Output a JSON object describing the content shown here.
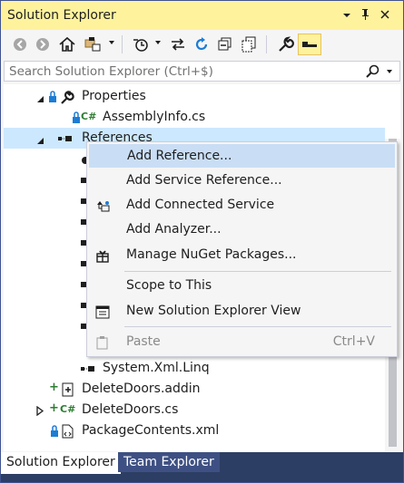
{
  "window": {
    "title": "Solution Explorer"
  },
  "search": {
    "placeholder": "Search Solution Explorer (Ctrl+$)"
  },
  "tree": {
    "properties": "Properties",
    "assembly_info": "AssemblyInfo.cs",
    "references": "References",
    "system_xml_linq": "System.Xml.Linq",
    "addin": "DeleteDoors.addin",
    "cs_file": "DeleteDoors.cs",
    "package_contents": "PackageContents.xml",
    "cs_badge": "C#"
  },
  "context_menu": {
    "items": [
      {
        "label": "Add Reference..."
      },
      {
        "label": "Add Service Reference..."
      },
      {
        "label": "Add Connected Service"
      },
      {
        "label": "Add Analyzer..."
      },
      {
        "label": "Manage NuGet Packages..."
      },
      {
        "label": "Scope to This"
      },
      {
        "label": "New Solution Explorer View"
      },
      {
        "label": "Paste",
        "shortcut": "Ctrl+V",
        "disabled": true
      }
    ]
  },
  "tabs": [
    {
      "label": "Solution Explorer"
    },
    {
      "label": "Team Explorer"
    }
  ],
  "colors": {
    "title_bar": "#fff29d",
    "selection": "#cce8ff",
    "menu_hover": "#c9def5",
    "tab_strip": "#2d3e64",
    "csharp_green": "#2e7d32",
    "lock_blue": "#1c7cd5"
  }
}
